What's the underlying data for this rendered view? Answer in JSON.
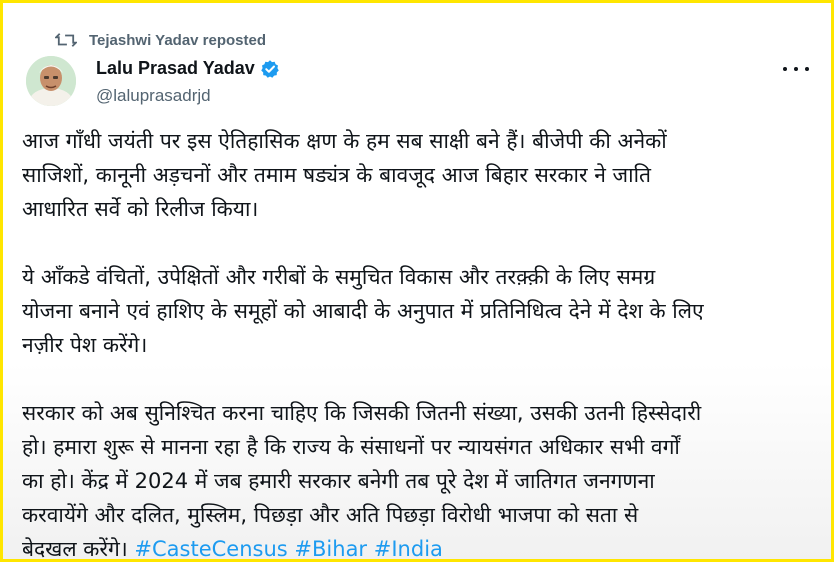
{
  "repost": {
    "text": "Tejashwi Yadav reposted"
  },
  "author": {
    "name": "Lalu Prasad Yadav",
    "handle": "@laluprasadrjd"
  },
  "tweet": {
    "paragraphs": [
      {
        "lines": [
          "आज गाँधी जयंती पर इस ऐतिहासिक क्षण के हम सब साक्षी बने हैं। बीजेपी की अनेकों",
          "साजिशों, कानूनी अड़चनों और तमाम षड्यंत्र के बावजूद आज बिहार सरकार ने जाति",
          "आधारित सर्वे को रिलीज किया।"
        ]
      },
      {
        "lines": [
          "ये आँकडे वंचितों, उपेक्षितों और गरीबों के समुचित विकास और तरक़्क़ी के लिए समग्र",
          "योजना बनाने एवं हाशिए के समूहों को आबादी के अनुपात में प्रतिनिधित्व देने में देश के लिए",
          "नज़ीर पेश करेंगे।"
        ]
      },
      {
        "lines": [
          "सरकार को अब सुनिश्चित करना चाहिए कि जिसकी जितनी संख्या, उसकी उतनी हिस्सेदारी",
          "हो। हमारा शुरू से मानना रहा है कि राज्य के संसाधनों पर न्यायसंगत अधिकार सभी वर्गों",
          "का हो। केंद्र में 2024 में जब हमारी सरकार बनेगी तब पूरे देश में जातिगत जनगणना",
          "करवायेंगे और दलित, मुस्लिम, पिछड़ा और अति पिछड़ा विरोधी भाजपा को सता से"
        ],
        "last_line_prefix": "बेदखल करेंगे।",
        "hashtags": [
          "#CasteCensus",
          "#Bihar",
          "#India"
        ]
      }
    ]
  },
  "icons": {
    "repost": "repost-icon",
    "verified": "verified-badge-icon",
    "more": "more-options-icon"
  },
  "colors": {
    "frame": "#ffe600",
    "text": "#0f1419",
    "secondary": "#536471",
    "link": "#1d9bf0"
  }
}
